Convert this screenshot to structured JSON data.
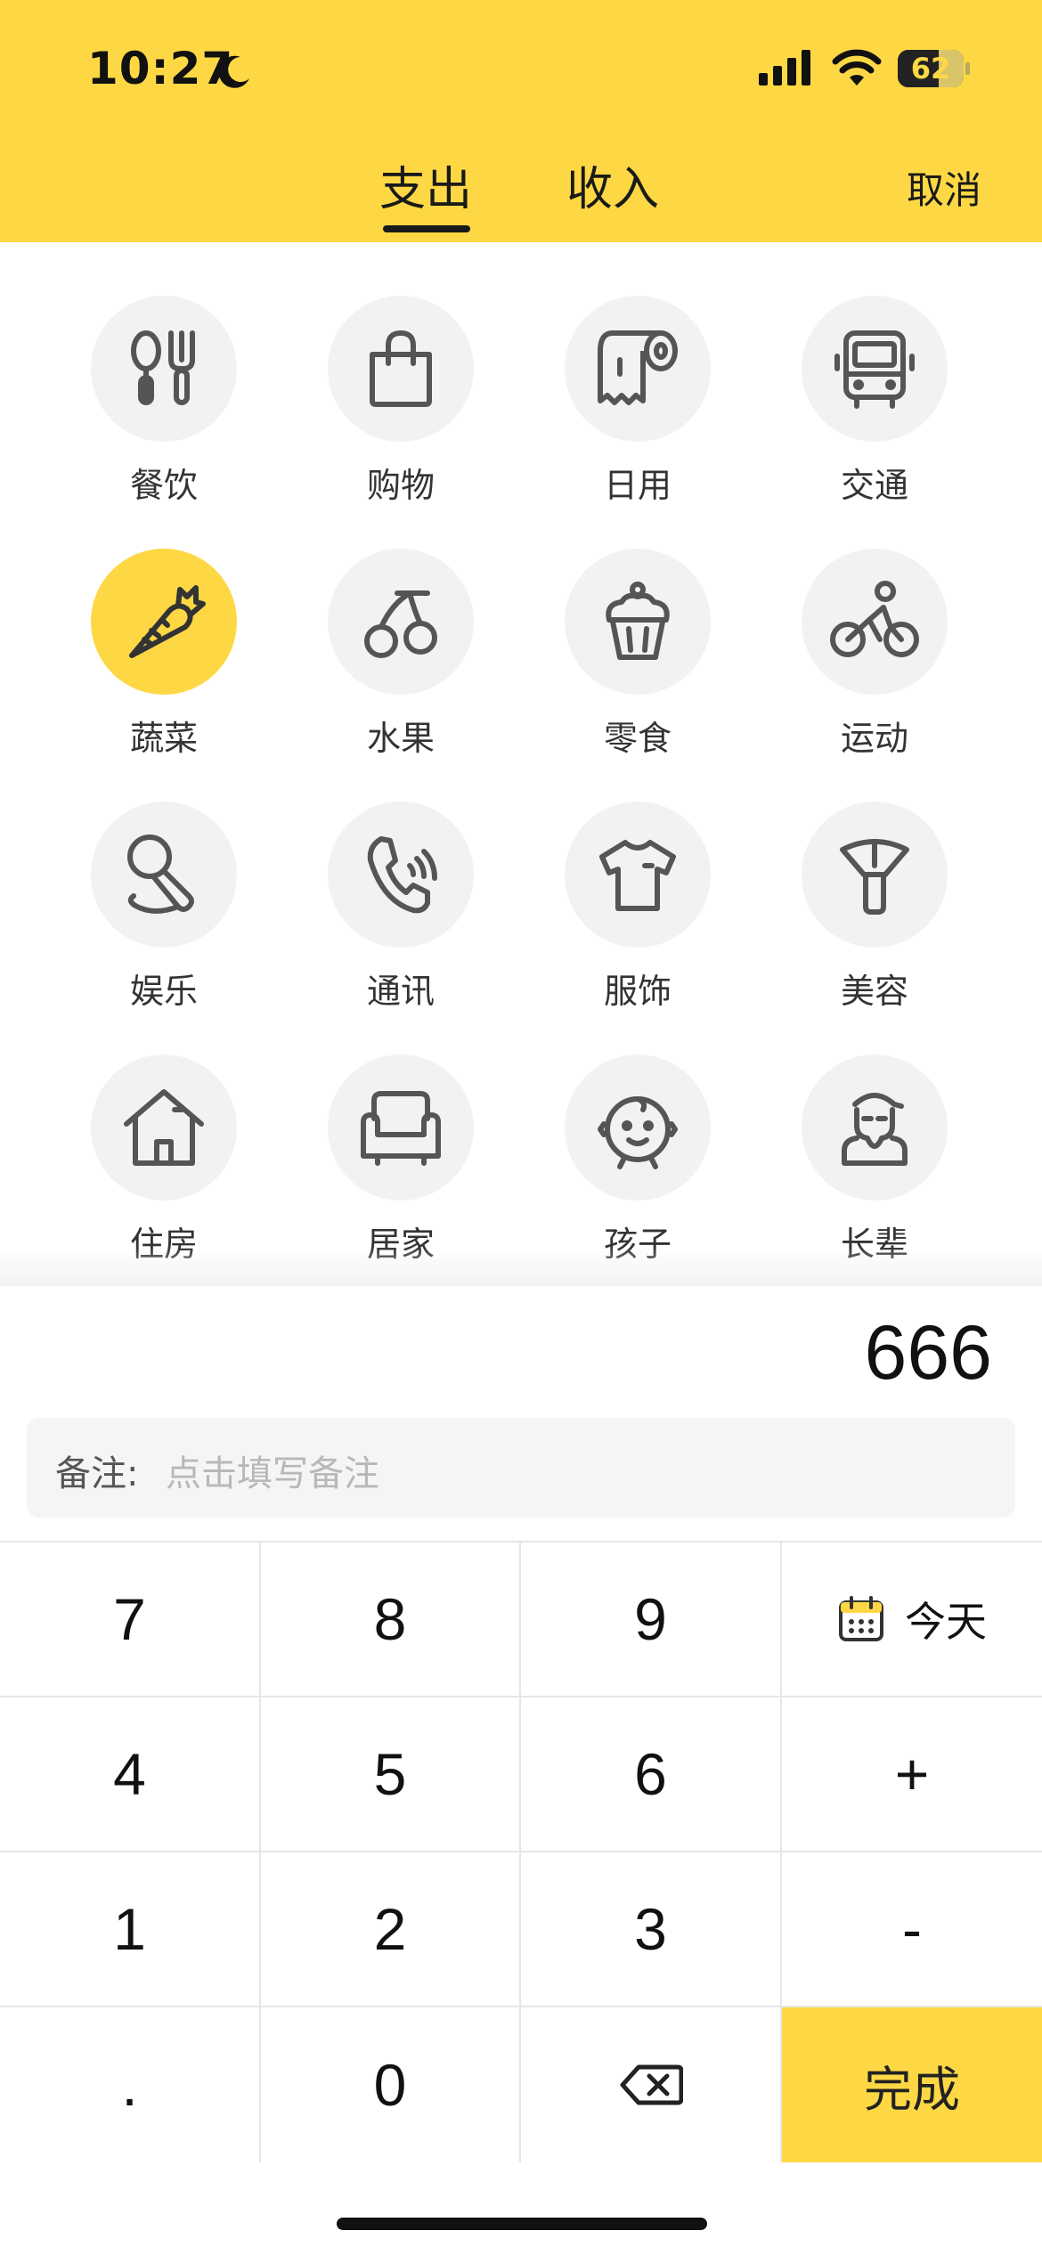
{
  "status_bar": {
    "time": "10:27",
    "battery": "62",
    "battery_level": 0.62,
    "icons": [
      "moon-icon",
      "signal-icon",
      "wifi-icon",
      "battery-icon"
    ]
  },
  "header": {
    "tabs": [
      {
        "label": "支出",
        "active": true
      },
      {
        "label": "收入",
        "active": false
      }
    ],
    "cancel_label": "取消",
    "accent_color": "#FED844"
  },
  "categories": [
    {
      "label": "餐饮",
      "icon": "utensils-icon",
      "selected": false
    },
    {
      "label": "购物",
      "icon": "shopping-bag-icon",
      "selected": false
    },
    {
      "label": "日用",
      "icon": "toilet-paper-icon",
      "selected": false
    },
    {
      "label": "交通",
      "icon": "bus-icon",
      "selected": false
    },
    {
      "label": "蔬菜",
      "icon": "carrot-icon",
      "selected": true
    },
    {
      "label": "水果",
      "icon": "cherry-icon",
      "selected": false
    },
    {
      "label": "零食",
      "icon": "cupcake-icon",
      "selected": false
    },
    {
      "label": "运动",
      "icon": "cycling-icon",
      "selected": false
    },
    {
      "label": "娱乐",
      "icon": "microphone-icon",
      "selected": false
    },
    {
      "label": "通讯",
      "icon": "phone-icon",
      "selected": false
    },
    {
      "label": "服饰",
      "icon": "tshirt-icon",
      "selected": false
    },
    {
      "label": "美容",
      "icon": "makeup-brush-icon",
      "selected": false
    },
    {
      "label": "住房",
      "icon": "house-icon",
      "selected": false
    },
    {
      "label": "居家",
      "icon": "armchair-icon",
      "selected": false
    },
    {
      "label": "孩子",
      "icon": "baby-icon",
      "selected": false
    },
    {
      "label": "长辈",
      "icon": "elder-icon",
      "selected": false
    }
  ],
  "entry": {
    "amount": "666",
    "note_label": "备注:",
    "note_placeholder": "点击填写备注"
  },
  "keypad": {
    "rows": [
      [
        "7",
        "8",
        "9",
        "今天"
      ],
      [
        "4",
        "5",
        "6",
        "+"
      ],
      [
        "1",
        "2",
        "3",
        "-"
      ],
      [
        ".",
        "0",
        "",
        "完成"
      ]
    ],
    "today_label": "今天",
    "done_label": "完成"
  }
}
